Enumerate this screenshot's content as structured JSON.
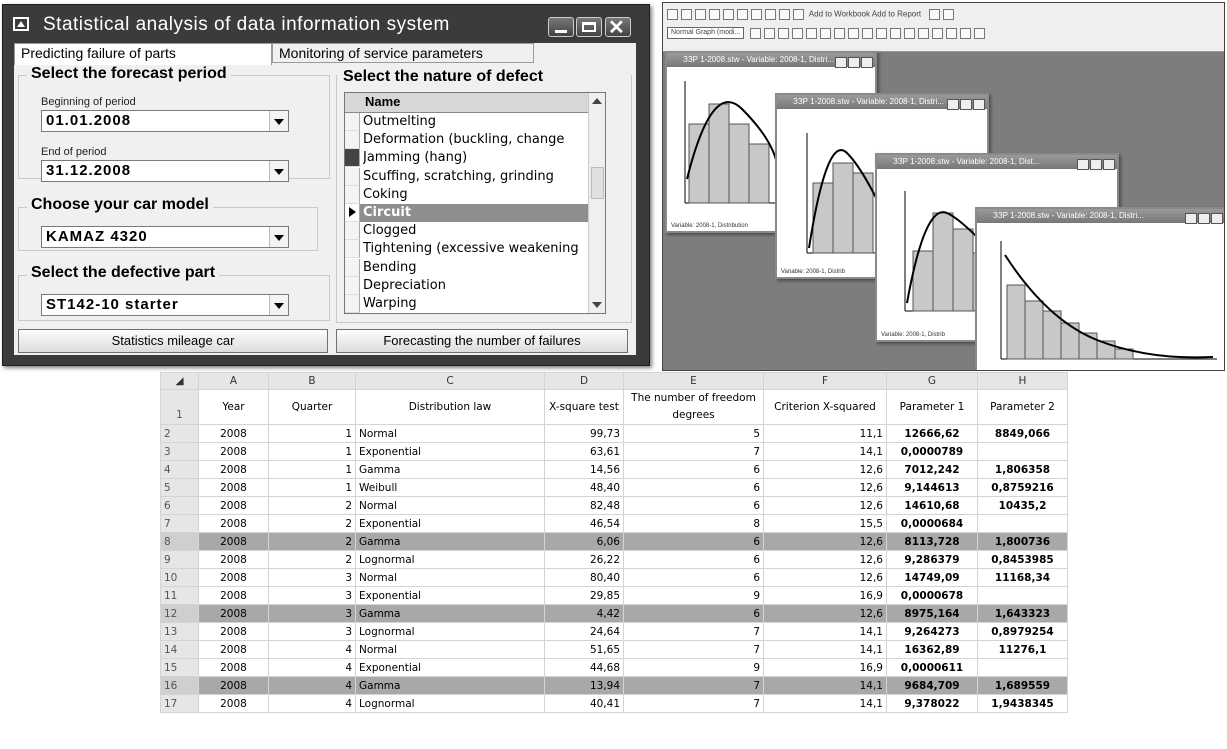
{
  "app": {
    "title": "Statistical analysis of data information system",
    "tabs": [
      "Predicting failure of parts",
      "Monitoring of service parameters"
    ],
    "forecast_period": {
      "title": "Select the forecast period",
      "begin_label": "Beginning of period",
      "begin_value": "01.01.2008",
      "end_label": "End of period",
      "end_value": "31.12.2008"
    },
    "car_model": {
      "title": "Choose your car model",
      "value": "KAMAZ 4320"
    },
    "defective_part": {
      "title": "Select the defective part",
      "value": "ST142-10 starter"
    },
    "defect": {
      "title": "Select the nature of defect",
      "header": "Name",
      "items": [
        "Outmelting",
        "Deformation (buckling, change",
        "Jamming (hang)",
        "Scuffing, scratching, grinding",
        "Coking",
        "Circuit",
        "Clogged",
        "Tightening (excessive weakening",
        "Bending",
        "Depreciation",
        "Warping"
      ],
      "selected": "Circuit"
    },
    "buttons": {
      "statistics": "Statistics mileage car",
      "forecasting": "Forecasting the number of failures"
    }
  },
  "graph_window": {
    "toolbar_combo": "Normal Graph (modi...",
    "toolbar_text": "Add to Workbook  Add to Report",
    "windows": [
      {
        "title": "ЗЗР 1-2008.stw - Variable: 2008-1, Distri...",
        "status": "Variable: 2008-1, Distribution"
      },
      {
        "title": "ЗЗР 1-2008.stw - Variable: 2008-1, Distri...",
        "status": "Variable: 2008-1, Distrib"
      },
      {
        "title": "ЗЗР 1-2008.stw - Variable: 2008-1, Dist...",
        "status": "Variable: 2008-1, Distrib"
      },
      {
        "title": "ЗЗР 1-2008.stw - Variable: 2008-1, Distri...",
        "status": ""
      }
    ]
  },
  "sheet": {
    "columns": [
      "A",
      "B",
      "C",
      "D",
      "E",
      "F",
      "G",
      "H"
    ],
    "header": [
      "Year",
      "Quarter",
      "Distribution law",
      "X-square test",
      "The number of freedom degrees",
      "Criterion X-squared",
      "Parameter 1",
      "Parameter 2"
    ],
    "rows": [
      [
        "2008",
        "1",
        "Normal",
        "99,73",
        "5",
        "11,1",
        "12666,62",
        "8849,066"
      ],
      [
        "2008",
        "1",
        "Exponential",
        "63,61",
        "7",
        "14,1",
        "0,0000789",
        ""
      ],
      [
        "2008",
        "1",
        "Gamma",
        "14,56",
        "6",
        "12,6",
        "7012,242",
        "1,806358"
      ],
      [
        "2008",
        "1",
        "Weibull",
        "48,40",
        "6",
        "12,6",
        "9,144613",
        "0,8759216"
      ],
      [
        "2008",
        "2",
        "Normal",
        "82,48",
        "6",
        "12,6",
        "14610,68",
        "10435,2"
      ],
      [
        "2008",
        "2",
        "Exponential",
        "46,54",
        "8",
        "15,5",
        "0,0000684",
        ""
      ],
      [
        "2008",
        "2",
        "Gamma",
        "6,06",
        "6",
        "12,6",
        "8113,728",
        "1,800736"
      ],
      [
        "2008",
        "2",
        "Lognormal",
        "26,22",
        "6",
        "12,6",
        "9,286379",
        "0,8453985"
      ],
      [
        "2008",
        "3",
        "Normal",
        "80,40",
        "6",
        "12,6",
        "14749,09",
        "11168,34"
      ],
      [
        "2008",
        "3",
        "Exponential",
        "29,85",
        "9",
        "16,9",
        "0,0000678",
        ""
      ],
      [
        "2008",
        "3",
        "Gamma",
        "4,42",
        "6",
        "12,6",
        "8975,164",
        "1,643323"
      ],
      [
        "2008",
        "3",
        "Lognormal",
        "24,64",
        "7",
        "14,1",
        "9,264273",
        "0,8979254"
      ],
      [
        "2008",
        "4",
        "Normal",
        "51,65",
        "7",
        "14,1",
        "16362,89",
        "11276,1"
      ],
      [
        "2008",
        "4",
        "Exponential",
        "44,68",
        "9",
        "16,9",
        "0,0000611",
        ""
      ],
      [
        "2008",
        "4",
        "Gamma",
        "13,94",
        "7",
        "14,1",
        "9684,709",
        "1,689559"
      ],
      [
        "2008",
        "4",
        "Lognormal",
        "40,41",
        "7",
        "14,1",
        "9,378022",
        "1,9438345"
      ]
    ],
    "highlighted_rows": [
      8,
      12,
      16
    ]
  }
}
